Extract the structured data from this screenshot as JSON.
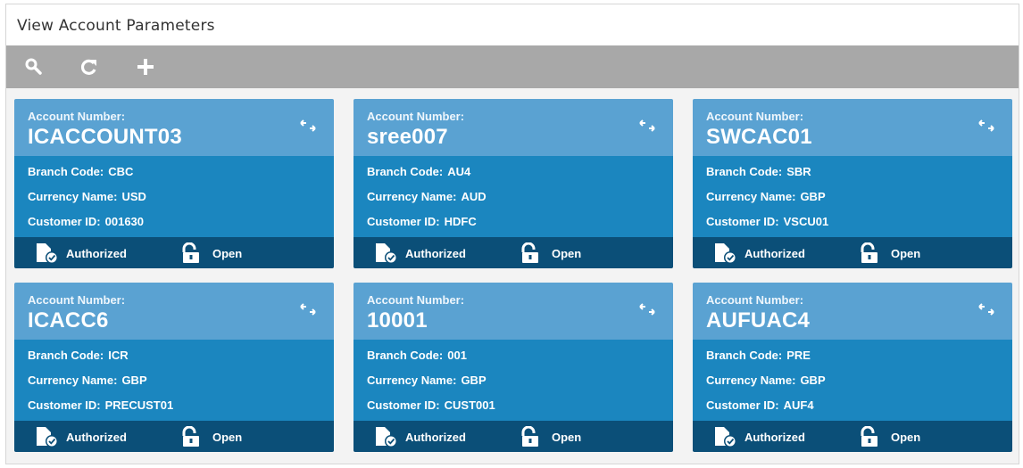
{
  "page": {
    "title": "View Account Parameters"
  },
  "toolbar": {
    "icons": [
      "search-icon",
      "refresh-icon",
      "add-icon"
    ]
  },
  "colors": {
    "toolbar": "#a8a8a8",
    "card_header": "#5aa2d2",
    "card_body": "#1b86bf",
    "card_footer": "#0b4f78"
  },
  "labels": {
    "account_number": "Account Number:",
    "branch_code": "Branch Code:",
    "currency_name": "Currency Name:",
    "customer_id": "Customer ID:"
  },
  "cards": [
    {
      "account_number": "ICACCOUNT03",
      "branch_code": "CBC",
      "currency_name": "USD",
      "customer_id": "001630",
      "auth_status": "Authorized",
      "record_status": "Open"
    },
    {
      "account_number": "sree007",
      "branch_code": "AU4",
      "currency_name": "AUD",
      "customer_id": "HDFC",
      "auth_status": "Authorized",
      "record_status": "Open"
    },
    {
      "account_number": "SWCAC01",
      "branch_code": "SBR",
      "currency_name": "GBP",
      "customer_id": "VSCU01",
      "auth_status": "Authorized",
      "record_status": "Open"
    },
    {
      "account_number": "ICACC6",
      "branch_code": "ICR",
      "currency_name": "GBP",
      "customer_id": "PRECUST01",
      "auth_status": "Authorized",
      "record_status": "Open"
    },
    {
      "account_number": "10001",
      "branch_code": "001",
      "currency_name": "GBP",
      "customer_id": "CUST001",
      "auth_status": "Authorized",
      "record_status": "Open"
    },
    {
      "account_number": "AUFUAC4",
      "branch_code": "PRE",
      "currency_name": "GBP",
      "customer_id": "AUF4",
      "auth_status": "Authorized",
      "record_status": "Open"
    }
  ]
}
